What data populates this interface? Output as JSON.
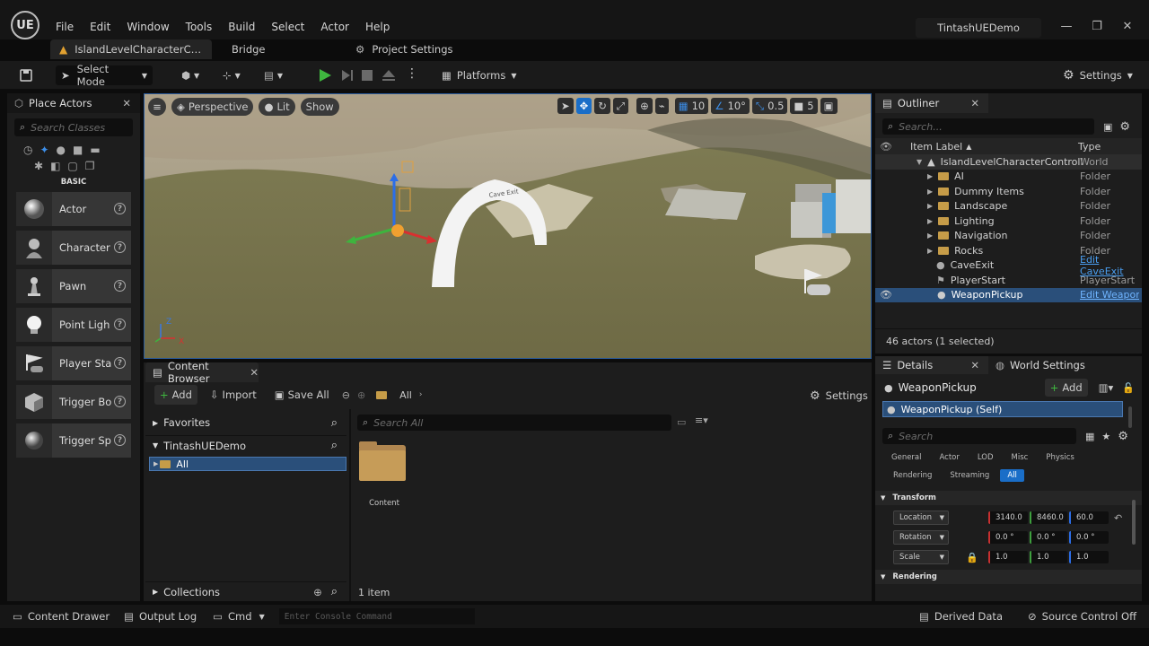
{
  "app": {
    "title": "TintashUEDemo",
    "logo": "UE"
  },
  "menu": [
    "File",
    "Edit",
    "Window",
    "Tools",
    "Build",
    "Select",
    "Actor",
    "Help"
  ],
  "tabs": {
    "level": "IslandLevelCharacterC…",
    "bridge": "Bridge",
    "project_settings": "Project Settings"
  },
  "toolbar": {
    "select_mode": "Select Mode",
    "platforms": "Platforms",
    "settings": "Settings"
  },
  "place_actors": {
    "title": "Place Actors",
    "search_placeholder": "Search Classes",
    "category": "BASIC",
    "items": [
      "Actor",
      "Character",
      "Pawn",
      "Point Ligh",
      "Player Sta",
      "Trigger Bo",
      "Trigger Sp"
    ]
  },
  "viewport": {
    "perspective": "Perspective",
    "lit": "Lit",
    "show": "Show",
    "grid_size": "10",
    "rot_snap": "10°",
    "scale_snap": "0.5",
    "cam_speed": "5",
    "sign_text": "Cave Exit",
    "axis_z": "Z",
    "axis_x": "X"
  },
  "content_browser": {
    "title": "Content Browser",
    "add": "Add",
    "import": "Import",
    "save_all": "Save All",
    "path": "All",
    "settings": "Settings",
    "favorites": "Favorites",
    "project": "TintashUEDemo",
    "tree_all": "All",
    "search_placeholder": "Search All",
    "asset": "Content",
    "count": "1 item",
    "collections": "Collections"
  },
  "outliner": {
    "title": "Outliner",
    "search_placeholder": "Search...",
    "col_label": "Item Label",
    "col_type": "Type",
    "root": {
      "label": "IslandLevelCharacterControll",
      "type": "World"
    },
    "folders": [
      {
        "label": "AI",
        "type": "Folder"
      },
      {
        "label": "Dummy Items",
        "type": "Folder"
      },
      {
        "label": "Landscape",
        "type": "Folder"
      },
      {
        "label": "Lighting",
        "type": "Folder"
      },
      {
        "label": "Navigation",
        "type": "Folder"
      },
      {
        "label": "Rocks",
        "type": "Folder"
      }
    ],
    "actors": [
      {
        "label": "CaveExit",
        "type": "Edit CaveExit"
      },
      {
        "label": "PlayerStart",
        "type": "PlayerStart"
      },
      {
        "label": "WeaponPickup",
        "type": "Edit WeaponI"
      }
    ],
    "status": "46 actors (1 selected)"
  },
  "details": {
    "title": "Details",
    "world_settings": "World Settings",
    "actor_name": "WeaponPickup",
    "add": "Add",
    "self": "WeaponPickup (Self)",
    "search_placeholder": "Search",
    "filters": [
      "General",
      "Actor",
      "LOD",
      "Misc",
      "Physics",
      "Rendering",
      "Streaming",
      "All"
    ],
    "transform": "Transform",
    "location_label": "Location",
    "rotation_label": "Rotation",
    "scale_label": "Scale",
    "location": [
      "3140.0",
      "8460.0",
      "60.0"
    ],
    "rotation": [
      "0.0 °",
      "0.0 °",
      "0.0 °"
    ],
    "scale": [
      "1.0",
      "1.0",
      "1.0"
    ],
    "rendering": "Rendering"
  },
  "statusbar": {
    "content_drawer": "Content Drawer",
    "output_log": "Output Log",
    "cmd": "Cmd",
    "console_placeholder": "Enter Console Command",
    "derived_data": "Derived Data",
    "source_control": "Source Control Off"
  },
  "colors": {
    "accent": "#1a6ec8",
    "play": "#3fb63f",
    "folder": "#c69c48",
    "selection": "#2a4f7a"
  }
}
